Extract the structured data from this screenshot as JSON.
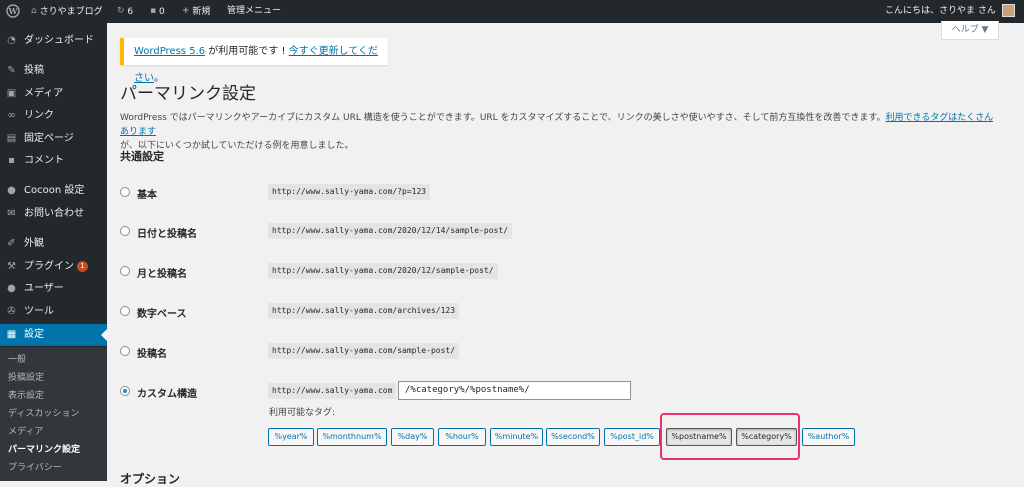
{
  "adminbar": {
    "site_name": "さりやまブログ",
    "updates_count": "6",
    "comments_count": "0",
    "new_label": "新規",
    "admin_menu_label": "管理メニュー",
    "greeting": "こんにちは、さりやま さん"
  },
  "sidebar": {
    "items": [
      {
        "label": "ダッシュボード",
        "icon": "dashboard-icon"
      },
      {
        "label": "投稿",
        "icon": "pin-icon"
      },
      {
        "label": "メディア",
        "icon": "media-icon"
      },
      {
        "label": "リンク",
        "icon": "link-icon"
      },
      {
        "label": "固定ページ",
        "icon": "page-icon"
      },
      {
        "label": "コメント",
        "icon": "comment-icon"
      },
      {
        "label": "Cocoon 設定",
        "icon": "cocoon-icon"
      },
      {
        "label": "お問い合わせ",
        "icon": "mail-icon"
      },
      {
        "label": "外観",
        "icon": "brush-icon"
      },
      {
        "label": "プラグイン",
        "icon": "plugin-icon",
        "badge": "1"
      },
      {
        "label": "ユーザー",
        "icon": "user-icon"
      },
      {
        "label": "ツール",
        "icon": "wrench-icon"
      },
      {
        "label": "設定",
        "icon": "settings-icon"
      }
    ],
    "submenu": [
      "一般",
      "投稿設定",
      "表示設定",
      "ディスカッション",
      "メディア",
      "パーマリンク設定",
      "プライバシー"
    ]
  },
  "notice": {
    "link1": "WordPress 5.6",
    "text": " が利用可能です ! ",
    "link2": "今すぐ更新してください",
    "end": "。"
  },
  "help_tab": "ヘルプ ▼",
  "page_title": "パーマリンク設定",
  "intro": {
    "text": "WordPress ではパーマリンクやアーカイブにカスタム URL 構造を使うことができます。URL をカスタマイズすることで、リンクの美しさや使いやすさ、そして前方互換性を改善できます。",
    "link": "利用できるタグはたくさんあります",
    "text2": "が、以下にいくつか試していただける例を用意しました。"
  },
  "common_heading": "共通設定",
  "options": [
    {
      "label": "基本",
      "example": "http://www.sally-yama.com/?p=123",
      "checked": false
    },
    {
      "label": "日付と投稿名",
      "example": "http://www.sally-yama.com/2020/12/14/sample-post/",
      "checked": false
    },
    {
      "label": "月と投稿名",
      "example": "http://www.sally-yama.com/2020/12/sample-post/",
      "checked": false
    },
    {
      "label": "数字ベース",
      "example": "http://www.sally-yama.com/archives/123",
      "checked": false
    },
    {
      "label": "投稿名",
      "example": "http://www.sally-yama.com/sample-post/",
      "checked": false
    },
    {
      "label": "カスタム構造",
      "example": "http://www.sally-yama.com",
      "checked": true
    }
  ],
  "custom_structure_value": "/%category%/%postname%/",
  "tags_label": "利用可能なタグ:",
  "tags": [
    "%year%",
    "%monthnum%",
    "%day%",
    "%hour%",
    "%minute%",
    "%second%",
    "%post_id%",
    "%postname%",
    "%category%",
    "%author%"
  ],
  "options_heading": "オプション",
  "colors": {
    "accent": "#0073aa",
    "admin_bg": "#23282d",
    "highlight": "#e8336d",
    "notice": "#ffb900"
  }
}
